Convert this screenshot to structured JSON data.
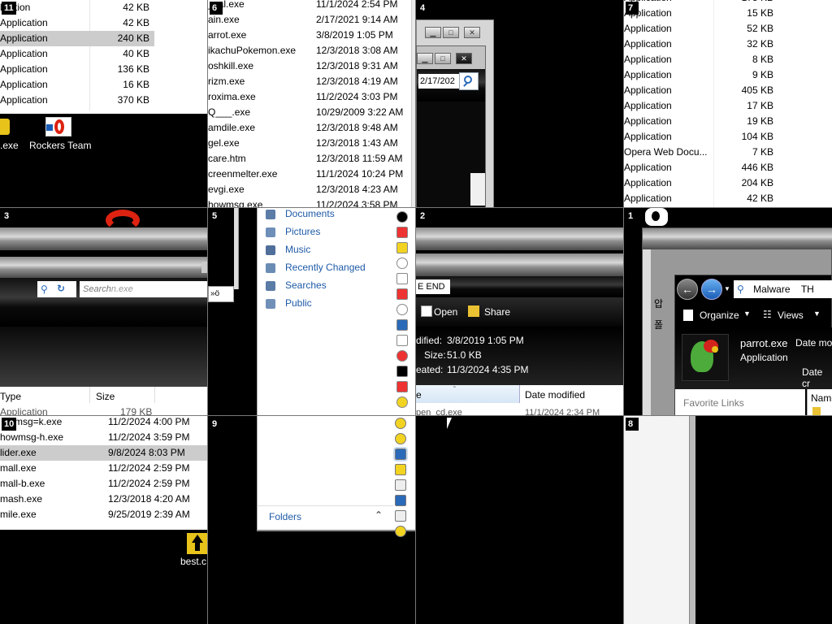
{
  "tiles": {
    "t11": {
      "num": "11",
      "rows": [
        {
          "type": "lication",
          "size": "42 KB"
        },
        {
          "type": "Application",
          "size": "42 KB"
        },
        {
          "type": "Application",
          "size": "240 KB"
        },
        {
          "type": "Application",
          "size": "40 KB"
        },
        {
          "type": "Application",
          "size": "136 KB"
        },
        {
          "type": "Application",
          "size": "16 KB"
        },
        {
          "type": "Application",
          "size": "370 KB"
        }
      ],
      "desktop_icons": [
        ".exe",
        "Rockers Team"
      ]
    },
    "t6": {
      "num": "6",
      "rows": [
        {
          "name": "_cal.exe",
          "date": "11/1/2024 2:54 PM"
        },
        {
          "name": "ain.exe",
          "date": "2/17/2021 9:14 AM"
        },
        {
          "name": "arrot.exe",
          "date": "3/8/2019 1:05 PM"
        },
        {
          "name": "ikachuPokemon.exe",
          "date": "12/3/2018 3:08 AM"
        },
        {
          "name": "oshkill.exe",
          "date": "12/3/2018 9:31 AM"
        },
        {
          "name": "rizm.exe",
          "date": "12/3/2018 4:19 AM"
        },
        {
          "name": "roxima.exe",
          "date": "11/2/2024 3:03 PM"
        },
        {
          "name": "Q___.exe",
          "date": "10/29/2009 3:22 AM"
        },
        {
          "name": "amdile.exe",
          "date": "12/3/2018 9:48 AM"
        },
        {
          "name": "gel.exe",
          "date": "12/3/2018 1:43 AM"
        },
        {
          "name": "care.htm",
          "date": "12/3/2018 11:59 AM"
        },
        {
          "name": "creenmelter.exe",
          "date": "11/1/2024 10:24 PM"
        },
        {
          "name": "evgi.exe",
          "date": "12/3/2018 4:23 AM"
        },
        {
          "name": "howmsg.exe",
          "date": "11/2/2024 3:58 PM"
        }
      ]
    },
    "t4": {
      "num": "4",
      "date_text": "2/17/202"
    },
    "t7": {
      "num": "7",
      "rows": [
        {
          "type": "Application",
          "size": "175 KB"
        },
        {
          "type": "Application",
          "size": "15 KB"
        },
        {
          "type": "Application",
          "size": "52 KB"
        },
        {
          "type": "Application",
          "size": "32 KB"
        },
        {
          "type": "Application",
          "size": "8 KB"
        },
        {
          "type": "Application",
          "size": "9 KB"
        },
        {
          "type": "Application",
          "size": "405 KB"
        },
        {
          "type": "Application",
          "size": "17 KB"
        },
        {
          "type": "Application",
          "size": "19 KB"
        },
        {
          "type": "Application",
          "size": "104 KB"
        },
        {
          "type": "Opera Web Docu...",
          "size": "7 KB"
        },
        {
          "type": "Application",
          "size": "446 KB"
        },
        {
          "type": "Application",
          "size": "204 KB"
        },
        {
          "type": "Application",
          "size": "42 KB"
        }
      ]
    },
    "t3": {
      "num": "3",
      "search_text": "Search",
      "search_suffix": "n.exe",
      "col_type": "Type",
      "col_size": "Size",
      "partial_row": {
        "type": "Application",
        "size": "179 KB"
      }
    },
    "t5": {
      "num": "5",
      "links": [
        "Documents",
        "Pictures",
        "Music",
        "Recently Changed",
        "Searches",
        "Public"
      ],
      "folders_label": "Folders"
    },
    "t2": {
      "num": "2",
      "title": "E END",
      "open_label": "Open",
      "share_label": "Share",
      "modified_label": "dified:",
      "modified_value": "3/8/2019 1:05 PM",
      "size_label": "Size:",
      "size_value": "51.0 KB",
      "created_label": "eated:",
      "created_value": "11/3/2024 4:35 PM",
      "col_name": "e",
      "col_date": "Date modified",
      "partial_row": {
        "name": "pen_cd.exe",
        "date": "11/1/2024 2:34 PM"
      }
    },
    "t1": {
      "num": "1",
      "address_text": "Malware",
      "address_more": "TH",
      "organize_label": "Organize",
      "views_label": "Views",
      "file_name": "parrot.exe",
      "file_type": "Application",
      "date_label": "Date mo",
      "date_label2": "Date cr",
      "favorite_links": "Favorite Links",
      "col_name": "Nam",
      "korean_1": "압",
      "korean_2": "폴"
    },
    "t10": {
      "num": "10",
      "rows": [
        {
          "name": "msg=k.exe",
          "date": "11/2/2024 4:00 PM"
        },
        {
          "name": "howmsg-h.exe",
          "date": "11/2/2024 3:59 PM"
        },
        {
          "name": "lider.exe",
          "date": "9/8/2024 8:03 PM"
        },
        {
          "name": "mall.exe",
          "date": "11/2/2024 2:59 PM"
        },
        {
          "name": "mall-b.exe",
          "date": "11/2/2024 2:59 PM"
        },
        {
          "name": "mash.exe",
          "date": "12/3/2018 4:20 AM"
        },
        {
          "name": "mile.exe",
          "date": "9/25/2019 2:39 AM"
        }
      ],
      "desktop_icon": "best.c"
    },
    "t9": {
      "num": "9"
    },
    "t8": {
      "num": "8"
    }
  },
  "colors": {
    "selection": "#cccccc",
    "link": "#1e5aa8",
    "background": "#000000"
  }
}
